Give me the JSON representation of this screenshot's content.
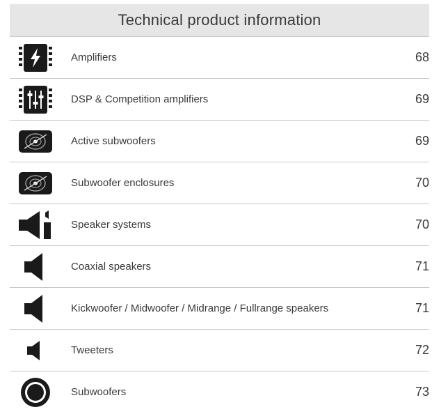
{
  "header": {
    "title": "Technical product information"
  },
  "items": [
    {
      "icon": "amplifier-bolt-icon",
      "label": "Amplifiers",
      "page": "68"
    },
    {
      "icon": "dsp-amplifier-icon",
      "label": "DSP & Competition amplifiers",
      "page": "69"
    },
    {
      "icon": "active-subwoofer-icon",
      "label": "Active subwoofers",
      "page": "69"
    },
    {
      "icon": "subwoofer-enclosure-icon",
      "label": "Subwoofer enclosures",
      "page": "70"
    },
    {
      "icon": "speaker-system-icon",
      "label": "Speaker systems",
      "page": "70"
    },
    {
      "icon": "coaxial-speaker-icon",
      "label": "Coaxial speakers",
      "page": "71"
    },
    {
      "icon": "kickwoofer-speaker-icon",
      "label": "Kickwoofer / Midwoofer / Midrange / Fullrange speakers",
      "page": "71"
    },
    {
      "icon": "tweeter-icon",
      "label": "Tweeters",
      "page": "72"
    },
    {
      "icon": "subwoofer-icon",
      "label": "Subwoofers",
      "page": "73"
    }
  ]
}
